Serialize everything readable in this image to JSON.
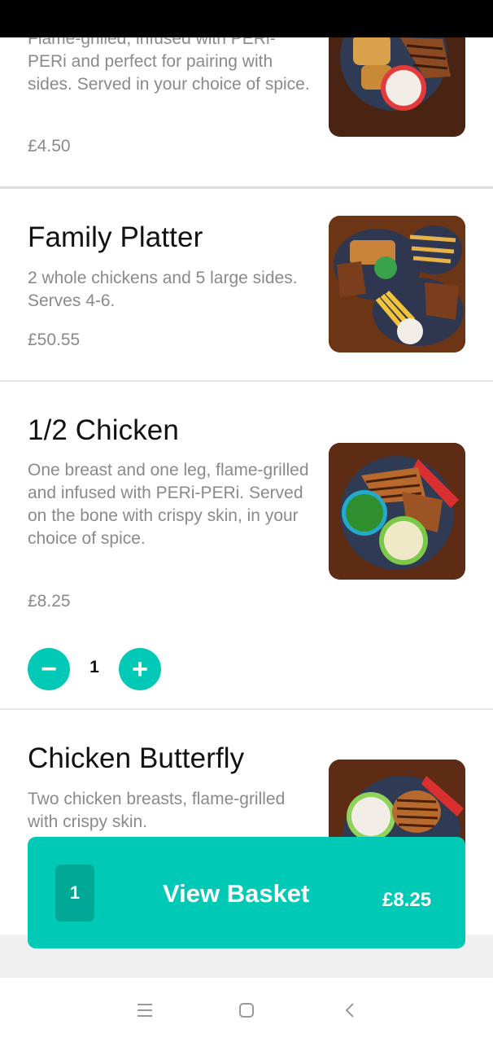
{
  "menu": {
    "items": [
      {
        "title": "",
        "description": "Flame-grilled, infused with PERi-PERi and perfect for pairing with sides. Served in your choice of spice.",
        "price": "£4.50",
        "image_icon": "chicken-plate-photo"
      },
      {
        "title": "Family Platter",
        "description": "2 whole chickens and 5 large sides. Serves 4-6.",
        "price": "£50.55",
        "image_icon": "family-platter-photo"
      },
      {
        "title": "1/2 Chicken",
        "description": "One breast and one leg, flame-grilled and infused with PERi-PERi. Served on the bone with crispy skin, in your choice of spice.",
        "price": "£8.25",
        "image_icon": "half-chicken-photo",
        "quantity": "1"
      },
      {
        "title": "Chicken Butterfly",
        "description": "Two chicken breasts, flame-grilled with crispy skin.",
        "price": "",
        "image_icon": "chicken-butterfly-photo"
      }
    ]
  },
  "stepper": {
    "decrement_icon": "minus-icon",
    "increment_icon": "plus-icon",
    "minus_glyph": "−",
    "plus_glyph": "+"
  },
  "basket": {
    "count": "1",
    "label": "View Basket",
    "total": "£8.25"
  },
  "nav": {
    "menu_icon": "menu-icon",
    "home_icon": "home-square-icon",
    "back_icon": "back-chevron-icon"
  },
  "colors": {
    "accent": "#00c9b5",
    "accent_dark": "#00a895",
    "text_primary": "#111111",
    "text_secondary": "#8a8a8a",
    "divider": "#e6e6e6"
  }
}
